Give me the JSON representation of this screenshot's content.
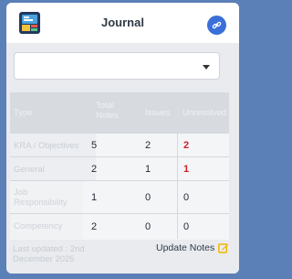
{
  "header": {
    "title": "Journal",
    "logo_icon": "journal-app-icon",
    "link_icon": "link-icon",
    "accent_color": "#3b6fd8"
  },
  "filter": {
    "selected": "",
    "icon": "chevron-down-icon"
  },
  "table": {
    "columns": [
      "Type",
      "Total Notes",
      "Issues",
      "Unresolved"
    ],
    "rows": [
      {
        "type": "KRA / Objectives",
        "total_notes": "5",
        "issues": "2",
        "unresolved": "2",
        "unresolved_alert": true
      },
      {
        "type": "General",
        "total_notes": "2",
        "issues": "1",
        "unresolved": "1",
        "unresolved_alert": true
      },
      {
        "type": "Job Responsibility",
        "total_notes": "1",
        "issues": "0",
        "unresolved": "0",
        "unresolved_alert": false
      },
      {
        "type": "Competency",
        "total_notes": "2",
        "issues": "0",
        "unresolved": "0",
        "unresolved_alert": false
      }
    ]
  },
  "footer": {
    "last_updated": "Last updated : 2nd December 2025",
    "update_label": "Update Notes",
    "update_icon": "edit-icon",
    "update_icon_color": "#f0b400"
  }
}
